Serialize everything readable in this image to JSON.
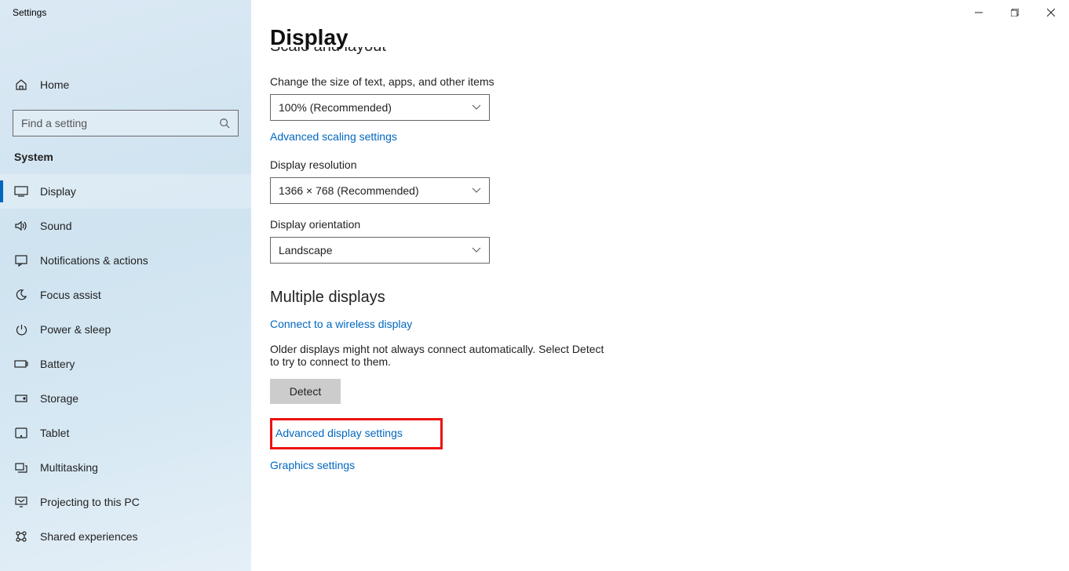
{
  "app_title": "Settings",
  "search": {
    "placeholder": "Find a setting"
  },
  "home_label": "Home",
  "category": "System",
  "nav": [
    {
      "label": "Display"
    },
    {
      "label": "Sound"
    },
    {
      "label": "Notifications & actions"
    },
    {
      "label": "Focus assist"
    },
    {
      "label": "Power & sleep"
    },
    {
      "label": "Battery"
    },
    {
      "label": "Storage"
    },
    {
      "label": "Tablet"
    },
    {
      "label": "Multitasking"
    },
    {
      "label": "Projecting to this PC"
    },
    {
      "label": "Shared experiences"
    }
  ],
  "page": {
    "title": "Display",
    "scale_section_partial": "Scale and layout",
    "scale_label": "Change the size of text, apps, and other items",
    "scale_value": "100% (Recommended)",
    "advanced_scaling_link": "Advanced scaling settings",
    "resolution_label": "Display resolution",
    "resolution_value": "1366 × 768 (Recommended)",
    "orientation_label": "Display orientation",
    "orientation_value": "Landscape",
    "multiple_heading": "Multiple displays",
    "connect_wireless_link": "Connect to a wireless display",
    "older_text": "Older displays might not always connect automatically. Select Detect to try to connect to them.",
    "detect_btn": "Detect",
    "advanced_display_link": "Advanced display settings",
    "graphics_link": "Graphics settings"
  }
}
